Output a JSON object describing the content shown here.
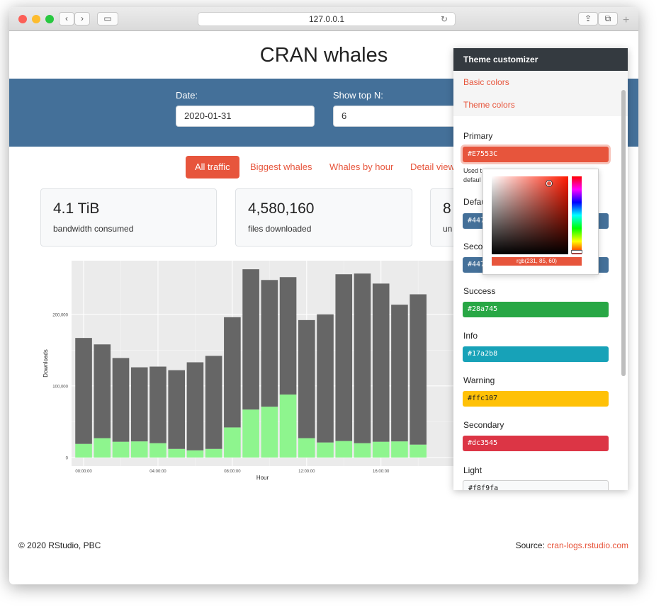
{
  "browser": {
    "url": "127.0.0.1"
  },
  "page": {
    "title": "CRAN whales"
  },
  "controls": {
    "date_label": "Date:",
    "date_value": "2020-01-31",
    "topn_label": "Show top N:",
    "topn_value": "6"
  },
  "nav": {
    "tabs": [
      "All traffic",
      "Biggest whales",
      "Whales by hour",
      "Detail view"
    ],
    "active": 0
  },
  "value_boxes": [
    {
      "value": "4.1 TiB",
      "label": "bandwidth consumed"
    },
    {
      "value": "4,580,160",
      "label": "files downloaded"
    },
    {
      "value": "8",
      "label": "un"
    }
  ],
  "chart_data": {
    "type": "bar",
    "stacked": true,
    "xlabel": "Hour",
    "ylabel": "Downloads",
    "x_tick_labels": [
      "00:00:00",
      "04:00:00",
      "08:00:00",
      "12:00:00",
      "16:00:00"
    ],
    "x_tick_hours": [
      0,
      4,
      8,
      12,
      16
    ],
    "y_tick_labels": [
      "0",
      "100,000",
      "200,000"
    ],
    "y_ticks": [
      0,
      100000,
      200000
    ],
    "ylim": [
      -12000,
      275000
    ],
    "categories": [
      "00",
      "01",
      "02",
      "03",
      "04",
      "05",
      "06",
      "07",
      "08",
      "09",
      "10",
      "11",
      "12",
      "13",
      "14",
      "15",
      "16",
      "17",
      "18"
    ],
    "series": [
      {
        "values": [
          19000,
          27000,
          22000,
          22500,
          20000,
          12000,
          10000,
          12000,
          42000,
          67000,
          71000,
          88000,
          27000,
          21000,
          23000,
          20000,
          22000,
          22500,
          18000
        ],
        "color": "#8ef58e"
      },
      {
        "values": [
          148000,
          131000,
          117000,
          103500,
          107000,
          110000,
          123000,
          130000,
          154000,
          196000,
          177000,
          164000,
          165000,
          179000,
          233000,
          237000,
          221000,
          191000,
          210000
        ],
        "color": "#666666"
      }
    ],
    "grid": true
  },
  "footer": {
    "copyright": "© 2020 RStudio, PBC",
    "source_label": "Source:",
    "source_link": "cran-logs.rstudio.com"
  },
  "theme_customizer": {
    "title": "Theme customizer",
    "sections": [
      "Basic colors",
      "Theme colors"
    ],
    "primary": {
      "label": "Primary",
      "value": "#E7553C",
      "color": "#e7553c"
    },
    "primary_help": "Used t",
    "primary_help_2": "defaul",
    "primary_help_tail": "ne",
    "picker_rgb": "rgb(231, 85, 60)",
    "colors": [
      {
        "label": "Defau",
        "value": "#447",
        "color": "#447099"
      },
      {
        "label": "Secon",
        "value": "#447",
        "color": "#447099"
      },
      {
        "label": "Success",
        "value": "#28a745",
        "color": "#28a745"
      },
      {
        "label": "Info",
        "value": "#17a2b8",
        "color": "#17a2b8"
      },
      {
        "label": "Warning",
        "value": "#ffc107",
        "color": "#ffc107"
      },
      {
        "label": "Secondary",
        "value": "#dc3545",
        "color": "#dc3545"
      },
      {
        "label": "Light",
        "value": "#f8f9fa",
        "color": "#f8f9fa"
      }
    ]
  }
}
